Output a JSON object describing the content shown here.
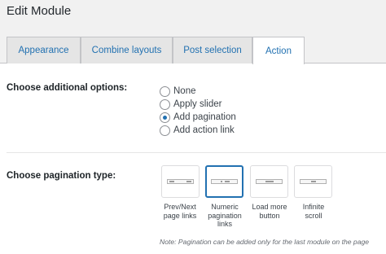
{
  "header": {
    "title": "Edit Module"
  },
  "tabs": [
    {
      "label": "Appearance"
    },
    {
      "label": "Combine layouts"
    },
    {
      "label": "Post selection"
    },
    {
      "label": "Action",
      "active": true
    }
  ],
  "options": {
    "label": "Choose additional options:",
    "items": [
      {
        "label": "None",
        "checked": false
      },
      {
        "label": "Apply slider",
        "checked": false
      },
      {
        "label": "Add pagination",
        "checked": true
      },
      {
        "label": "Add action link",
        "checked": false
      }
    ]
  },
  "pagination": {
    "label": "Choose pagination type:",
    "types": [
      {
        "caption_line1": "Prev/Next",
        "caption_line2": "page links",
        "caption_line3": "",
        "icon": "prev-next-pagination-icon",
        "selected": false
      },
      {
        "caption_line1": "Numeric",
        "caption_line2": "pagination",
        "caption_line3": "links",
        "icon": "numeric-pagination-icon",
        "selected": true
      },
      {
        "caption_line1": "Load more",
        "caption_line2": "button",
        "caption_line3": "",
        "icon": "load-more-icon",
        "selected": false
      },
      {
        "caption_line1": "Infinite",
        "caption_line2": "scroll",
        "caption_line3": "",
        "icon": "infinite-scroll-icon",
        "selected": false
      }
    ],
    "note": "Note: Pagination can be added only for the last module on the page"
  },
  "colors": {
    "accent": "#2271b1",
    "tab_bg": "#e5e5e5",
    "header_bg": "#f1f1f1"
  }
}
